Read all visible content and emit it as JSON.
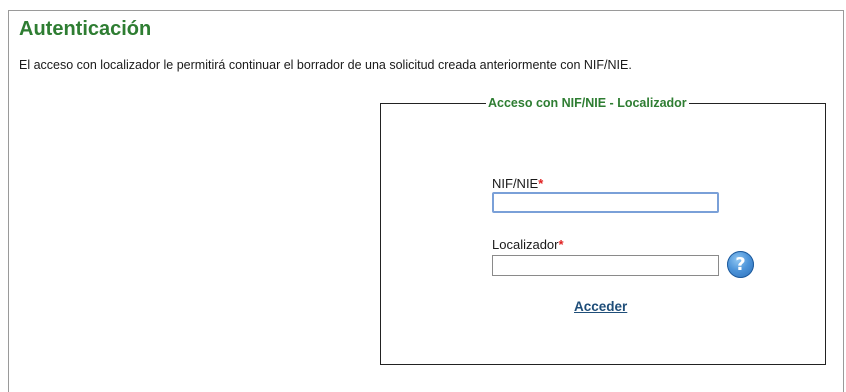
{
  "page": {
    "title": "Autenticación",
    "intro": "El acceso con localizador le permitirá continuar el borrador de una solicitud creada anteriormente con NIF/NIE."
  },
  "panel": {
    "legend": "Acceso con NIF/NIE - Localizador",
    "fields": [
      {
        "label": "NIF/NIE",
        "required_mark": "*",
        "value": "",
        "focused": true
      },
      {
        "label": "Localizador",
        "required_mark": "*",
        "value": "",
        "focused": false
      }
    ],
    "help_icon": {
      "name": "help-icon",
      "glyph": "?"
    },
    "submit_label": "Acceder"
  },
  "colors": {
    "title_green": "#2e7d32",
    "required_red": "#e02020",
    "link_blue": "#1f4e79",
    "help_blue": "#4d94d9"
  }
}
